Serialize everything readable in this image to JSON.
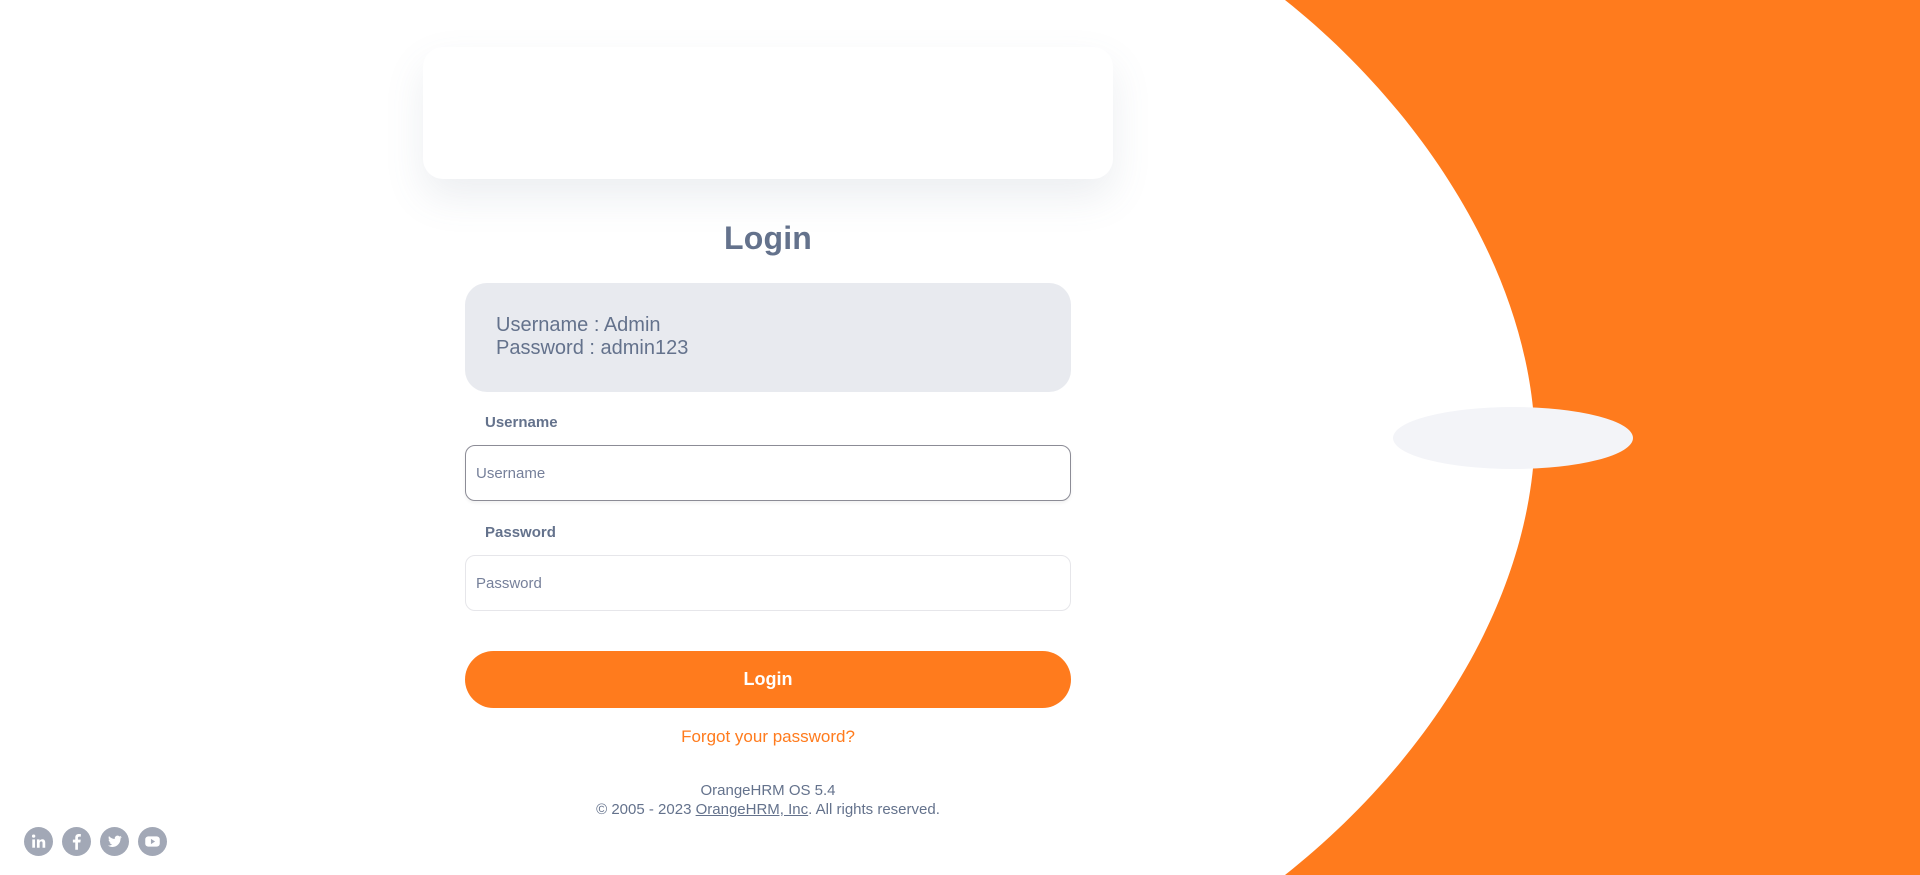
{
  "title": "Login",
  "credentials": {
    "username_line": "Username : Admin",
    "password_line": "Password : admin123"
  },
  "form": {
    "username_label": "Username",
    "username_placeholder": "Username",
    "password_label": "Password",
    "password_placeholder": "Password",
    "login_button": "Login"
  },
  "links": {
    "forgot_password": "Forgot your password?"
  },
  "footer": {
    "version": "OrangeHRM OS 5.4",
    "copyright_prefix": "© 2005 - 2023 ",
    "company_link": "OrangeHRM, Inc",
    "copyright_suffix": ". All rights reserved."
  },
  "social_icons": [
    "linkedin-icon",
    "facebook-icon",
    "twitter-icon",
    "youtube-icon"
  ],
  "colors": {
    "accent": "#ff7b1d",
    "text": "#64728c",
    "muted_panel": "#e8eaef",
    "icon_gray": "#a2a8b6"
  }
}
